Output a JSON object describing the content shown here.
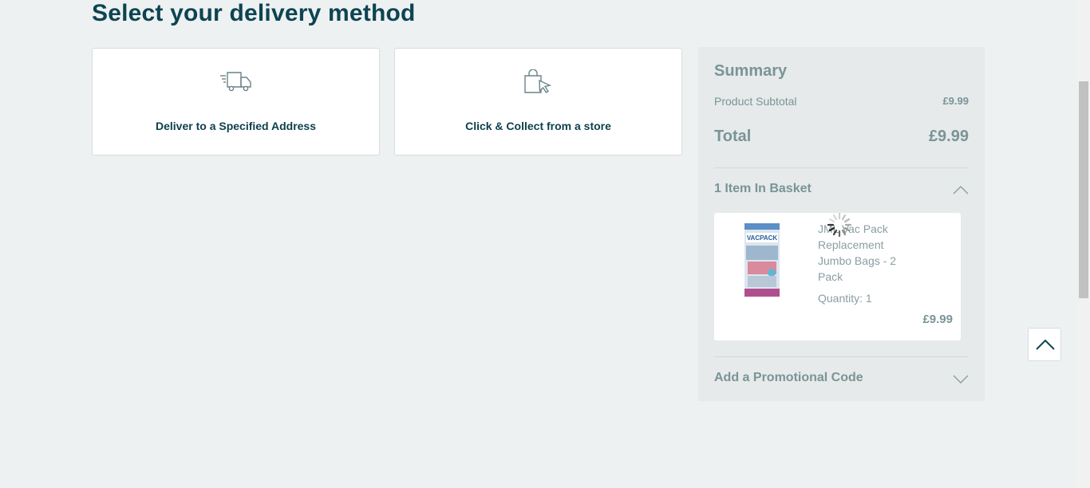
{
  "page": {
    "title": "Select your delivery method"
  },
  "delivery_options": [
    {
      "label": "Deliver to a Specified Address",
      "icon": "delivery-truck-icon"
    },
    {
      "label": "Click & Collect from a store",
      "icon": "shopping-bag-cursor-icon"
    }
  ],
  "summary": {
    "title": "Summary",
    "subtotal_label": "Product Subtotal",
    "subtotal_value": "£9.99",
    "total_label": "Total",
    "total_value": "£9.99",
    "basket_header": "1 Item In Basket",
    "promo_label": "Add a Promotional Code"
  },
  "basket_item": {
    "name": "JML Vac Pack Replacement Jumbo Bags - 2 Pack",
    "quantity": "Quantity: 1",
    "price": "£9.99",
    "image_text": "VACPACK"
  },
  "colors": {
    "title": "#0d4452",
    "muted": "#7a9498",
    "background": "#eef1f1",
    "summary_bg": "#e6eaea"
  }
}
